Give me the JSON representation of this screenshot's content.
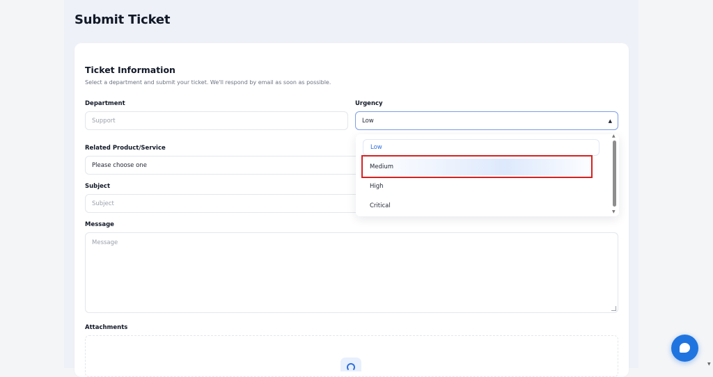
{
  "page": {
    "title": "Submit Ticket"
  },
  "form": {
    "section_title": "Ticket Information",
    "section_description": "Select a department and submit your ticket. We'll respond by email as soon as possible.",
    "department": {
      "label": "Department",
      "placeholder": "Support"
    },
    "urgency": {
      "label": "Urgency",
      "value": "Low"
    },
    "related": {
      "label": "Related Product/Service",
      "value": "Please choose one"
    },
    "subject": {
      "label": "Subject",
      "placeholder": "Subject"
    },
    "message": {
      "label": "Message",
      "placeholder": "Message"
    },
    "attachments": {
      "label": "Attachments"
    }
  },
  "urgency_dropdown": {
    "options": [
      "Low",
      "Medium",
      "High",
      "Critical"
    ],
    "selected": "Low",
    "hovered": "Medium"
  },
  "icons": {
    "chevron": "chevron-up-icon",
    "upload": "upload-icon",
    "chat": "chat-icon"
  },
  "colors": {
    "accent": "#1f74e0",
    "selected_option": "#2f6fe0",
    "highlight_border": "#d62020",
    "focus_border": "#7b9ee6"
  }
}
